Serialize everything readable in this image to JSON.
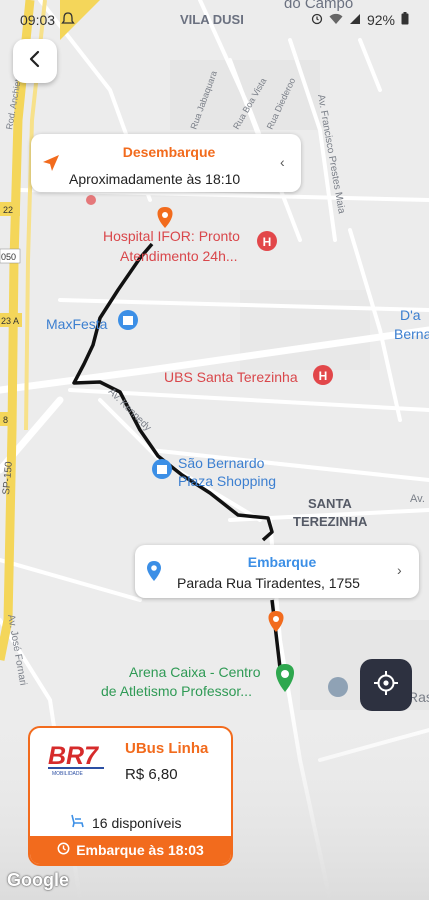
{
  "status_bar": {
    "time": "09:03",
    "battery": "92%"
  },
  "map": {
    "labels": {
      "vila_dusi": "VILA DUSI",
      "do_campo": "do Campo",
      "av_francisco": "Av. Francisco Prestes Maia",
      "hospital_1": "Hospital IFOR: Pronto",
      "hospital_2": "Atendimento 24h...",
      "maxfesta": "MaxFesta",
      "ubs": "UBS Santa Terezinha",
      "av_kennedy": "Av. Kennedy",
      "sao_bernardo_1": "São Bernardo",
      "sao_bernardo_2": "Plaza Shopping",
      "santa_1": "SANTA",
      "santa_2": "TEREZINHA",
      "arena_1": "Arena Caixa - Centro",
      "arena_2": "de Atletismo Professor...",
      "av_jose": "Av. José Fornari",
      "berna": "Berna",
      "da": "D'a",
      "rasa": "Rasa",
      "av_right": "Av.",
      "road_22": "22",
      "road_050": "050",
      "road_23a": "23 A",
      "road_8": "8",
      "road_sp150": "SP-150",
      "rua_diadema": "Rod. Anchieta",
      "rua_fortaleza": "Rua Boa Vista",
      "rua_diederoo": "Rua Diederoo",
      "rua_sambatuba": "Rua Jabaquara"
    },
    "google": "Google"
  },
  "drop_off": {
    "title": "Desembarque",
    "subtitle": "Aproximadamente às 18:10"
  },
  "boarding": {
    "title": "Embarque",
    "subtitle": "Parada Rua Tiradentes, 1755"
  },
  "trip": {
    "brand": "BR7",
    "brand_sub": "MOBILIDADE",
    "line": "UBus Linha",
    "price": "R$ 6,80",
    "seats": "16 disponíveis",
    "footer": "Embarque às 18:03"
  },
  "colors": {
    "accent": "#f26b1d",
    "blue": "#3c8fe6",
    "route": "#111111",
    "green": "#2fa84f",
    "hospital_red": "#e2474a",
    "locate_bg": "#2d3140",
    "highway": "#f4d65a"
  },
  "icons": {
    "back": "arrow-left-icon",
    "navigation": "navigation-arrow-icon",
    "location_pin": "location-pin-icon",
    "chevron": "chevron-icon",
    "locate": "crosshair-locate-icon",
    "seat": "seat-icon",
    "clock": "clock-icon"
  }
}
